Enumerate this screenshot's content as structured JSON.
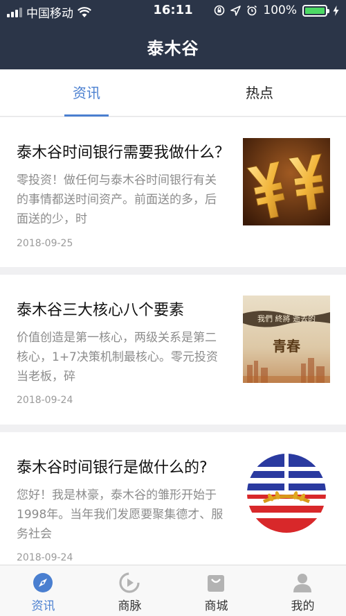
{
  "status_bar": {
    "carrier": "中国移动",
    "time": "16:11",
    "battery": "100%",
    "battery_level": 1.0
  },
  "header": {
    "title": "泰木谷"
  },
  "tabs": [
    {
      "label": "资讯",
      "active": true
    },
    {
      "label": "热点",
      "active": false
    }
  ],
  "articles": [
    {
      "title": "泰木谷时间银行需要我做什么？",
      "snippet": "零投资！做任何与泰木谷时间银行有关的事情都送时间资产。前面送的多，后面送的少，时",
      "date": "2018-09-25",
      "thumb": "yen-sign-image"
    },
    {
      "title": "泰木谷三大核心八个要素",
      "snippet": "价值创造是第一核心，两级关系是第二核心，1+7决策机制最核心。零元投资当老板，碎",
      "date": "2018-09-24",
      "thumb": "youth-banner-image",
      "thumb_text_top": "我們 終將 逝去的",
      "thumb_text_main": "青春"
    },
    {
      "title": "泰木谷时间银行是做什么的?",
      "snippet": "您好！我是林豪，泰木谷的雏形开始于1998年。当年我们发愿要聚集德才、服务社会",
      "date": "2018-09-24",
      "thumb": "round-flag-logo"
    }
  ],
  "bottom_nav": [
    {
      "label": "资讯",
      "icon": "compass-icon",
      "active": true
    },
    {
      "label": "商脉",
      "icon": "play-circle-icon",
      "active": false
    },
    {
      "label": "商城",
      "icon": "shopping-bag-icon",
      "active": false
    },
    {
      "label": "我的",
      "icon": "user-icon",
      "active": false
    }
  ],
  "colors": {
    "header_bg": "#2b3548",
    "accent": "#4a7fd0",
    "battery": "#4cd964"
  }
}
